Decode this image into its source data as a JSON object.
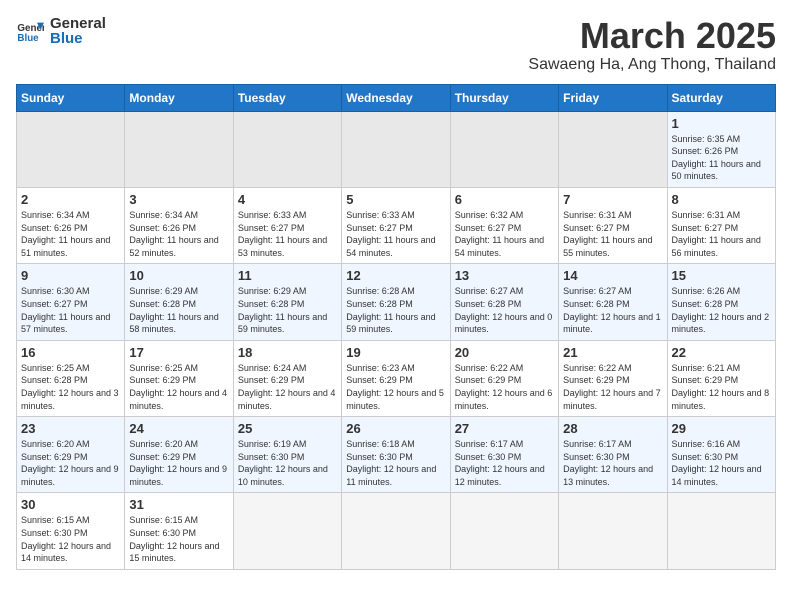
{
  "header": {
    "logo_general": "General",
    "logo_blue": "Blue",
    "month_title": "March 2025",
    "subtitle": "Sawaeng Ha, Ang Thong, Thailand"
  },
  "days_of_week": [
    "Sunday",
    "Monday",
    "Tuesday",
    "Wednesday",
    "Thursday",
    "Friday",
    "Saturday"
  ],
  "weeks": [
    [
      {
        "day": "",
        "empty": true
      },
      {
        "day": "",
        "empty": true
      },
      {
        "day": "",
        "empty": true
      },
      {
        "day": "",
        "empty": true
      },
      {
        "day": "",
        "empty": true
      },
      {
        "day": "",
        "empty": true
      },
      {
        "day": "1",
        "sunrise": "6:35 AM",
        "sunset": "6:26 PM",
        "daylight": "11 hours and 50 minutes."
      }
    ],
    [
      {
        "day": "2",
        "sunrise": "6:34 AM",
        "sunset": "6:26 PM",
        "daylight": "11 hours and 51 minutes."
      },
      {
        "day": "3",
        "sunrise": "6:34 AM",
        "sunset": "6:26 PM",
        "daylight": "11 hours and 52 minutes."
      },
      {
        "day": "4",
        "sunrise": "6:33 AM",
        "sunset": "6:27 PM",
        "daylight": "11 hours and 53 minutes."
      },
      {
        "day": "5",
        "sunrise": "6:33 AM",
        "sunset": "6:27 PM",
        "daylight": "11 hours and 54 minutes."
      },
      {
        "day": "6",
        "sunrise": "6:32 AM",
        "sunset": "6:27 PM",
        "daylight": "11 hours and 54 minutes."
      },
      {
        "day": "7",
        "sunrise": "6:31 AM",
        "sunset": "6:27 PM",
        "daylight": "11 hours and 55 minutes."
      },
      {
        "day": "8",
        "sunrise": "6:31 AM",
        "sunset": "6:27 PM",
        "daylight": "11 hours and 56 minutes."
      }
    ],
    [
      {
        "day": "9",
        "sunrise": "6:30 AM",
        "sunset": "6:27 PM",
        "daylight": "11 hours and 57 minutes."
      },
      {
        "day": "10",
        "sunrise": "6:29 AM",
        "sunset": "6:28 PM",
        "daylight": "11 hours and 58 minutes."
      },
      {
        "day": "11",
        "sunrise": "6:29 AM",
        "sunset": "6:28 PM",
        "daylight": "11 hours and 59 minutes."
      },
      {
        "day": "12",
        "sunrise": "6:28 AM",
        "sunset": "6:28 PM",
        "daylight": "11 hours and 59 minutes."
      },
      {
        "day": "13",
        "sunrise": "6:27 AM",
        "sunset": "6:28 PM",
        "daylight": "12 hours and 0 minutes."
      },
      {
        "day": "14",
        "sunrise": "6:27 AM",
        "sunset": "6:28 PM",
        "daylight": "12 hours and 1 minute."
      },
      {
        "day": "15",
        "sunrise": "6:26 AM",
        "sunset": "6:28 PM",
        "daylight": "12 hours and 2 minutes."
      }
    ],
    [
      {
        "day": "16",
        "sunrise": "6:25 AM",
        "sunset": "6:28 PM",
        "daylight": "12 hours and 3 minutes."
      },
      {
        "day": "17",
        "sunrise": "6:25 AM",
        "sunset": "6:29 PM",
        "daylight": "12 hours and 4 minutes."
      },
      {
        "day": "18",
        "sunrise": "6:24 AM",
        "sunset": "6:29 PM",
        "daylight": "12 hours and 4 minutes."
      },
      {
        "day": "19",
        "sunrise": "6:23 AM",
        "sunset": "6:29 PM",
        "daylight": "12 hours and 5 minutes."
      },
      {
        "day": "20",
        "sunrise": "6:22 AM",
        "sunset": "6:29 PM",
        "daylight": "12 hours and 6 minutes."
      },
      {
        "day": "21",
        "sunrise": "6:22 AM",
        "sunset": "6:29 PM",
        "daylight": "12 hours and 7 minutes."
      },
      {
        "day": "22",
        "sunrise": "6:21 AM",
        "sunset": "6:29 PM",
        "daylight": "12 hours and 8 minutes."
      }
    ],
    [
      {
        "day": "23",
        "sunrise": "6:20 AM",
        "sunset": "6:29 PM",
        "daylight": "12 hours and 9 minutes."
      },
      {
        "day": "24",
        "sunrise": "6:20 AM",
        "sunset": "6:29 PM",
        "daylight": "12 hours and 9 minutes."
      },
      {
        "day": "25",
        "sunrise": "6:19 AM",
        "sunset": "6:30 PM",
        "daylight": "12 hours and 10 minutes."
      },
      {
        "day": "26",
        "sunrise": "6:18 AM",
        "sunset": "6:30 PM",
        "daylight": "12 hours and 11 minutes."
      },
      {
        "day": "27",
        "sunrise": "6:17 AM",
        "sunset": "6:30 PM",
        "daylight": "12 hours and 12 minutes."
      },
      {
        "day": "28",
        "sunrise": "6:17 AM",
        "sunset": "6:30 PM",
        "daylight": "12 hours and 13 minutes."
      },
      {
        "day": "29",
        "sunrise": "6:16 AM",
        "sunset": "6:30 PM",
        "daylight": "12 hours and 14 minutes."
      }
    ],
    [
      {
        "day": "30",
        "sunrise": "6:15 AM",
        "sunset": "6:30 PM",
        "daylight": "12 hours and 14 minutes."
      },
      {
        "day": "31",
        "sunrise": "6:15 AM",
        "sunset": "6:30 PM",
        "daylight": "12 hours and 15 minutes."
      },
      {
        "day": "",
        "empty": true
      },
      {
        "day": "",
        "empty": true
      },
      {
        "day": "",
        "empty": true
      },
      {
        "day": "",
        "empty": true
      },
      {
        "day": "",
        "empty": true
      }
    ]
  ]
}
